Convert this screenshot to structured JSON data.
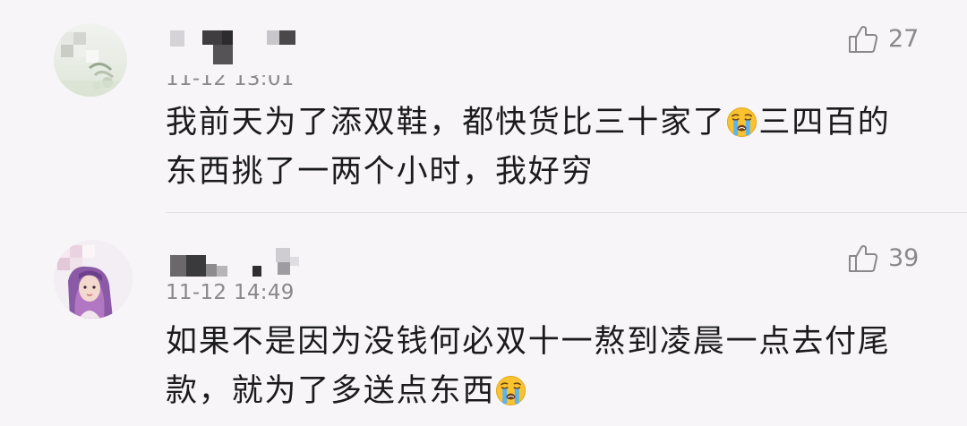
{
  "colors": {
    "background": "#f7f5f8",
    "text": "#1b1b1b",
    "meta": "#8a888c",
    "divider": "#e5e2e7"
  },
  "like_icon": "thumbs-up-icon",
  "comments": [
    {
      "timestamp": "11-12 13:01",
      "likes": "27",
      "text_before": "我前天为了添双鞋，都快货比三十家了",
      "emoji": "loudly-crying-face",
      "text_after": "三四百的东西挑了一两个小时，我好穷"
    },
    {
      "timestamp": "11-12 14:49",
      "likes": "39",
      "text_before": "如果不是因为没钱何必双十一熬到凌晨一点去付尾款，就为了多送点东西",
      "emoji": "loudly-crying-face"
    }
  ]
}
